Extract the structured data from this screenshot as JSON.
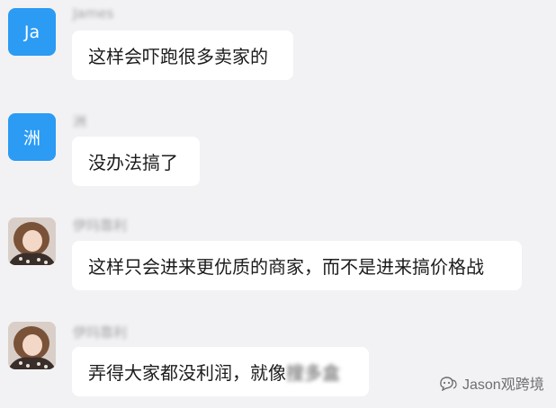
{
  "messages": [
    {
      "avatar_text": "Ja",
      "sender": "James",
      "text": "这样会吓跑很多卖家的"
    },
    {
      "avatar_text": "洲",
      "sender": "洲",
      "text": "没办法搞了"
    },
    {
      "avatar_text": "",
      "sender": "伊玛靠利",
      "text": "这样只会进来更优质的商家，而不是进来搞价格战"
    },
    {
      "avatar_text": "",
      "sender": "伊玛靠利",
      "text": "弄得大家都没利润，就像",
      "text_blurred": "搜多盒"
    }
  ],
  "watermark": {
    "label": "Jason观跨境",
    "icon": "wechat-official-account-icon"
  },
  "colors": {
    "background": "#f2f2f4",
    "avatar_blue": "#2b9bf4",
    "bubble": "#ffffff"
  }
}
